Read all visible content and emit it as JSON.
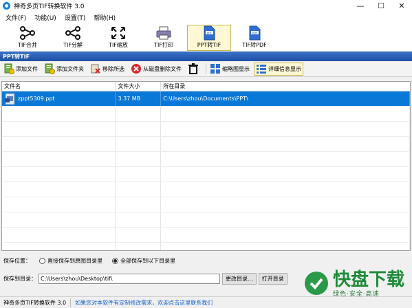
{
  "window": {
    "title": "神奇多页TIF转换软件 3.0",
    "controls": [
      "—",
      "☐",
      "✕"
    ]
  },
  "menu": [
    "文件(F)",
    "功能(U)",
    "设置(T)",
    "帮助(H)"
  ],
  "toolbar": [
    {
      "label": "TIF合并",
      "icon": "merge-icon",
      "active": false
    },
    {
      "label": "TIF分解",
      "icon": "split-icon",
      "active": false
    },
    {
      "label": "TIF缩放",
      "icon": "scale-icon",
      "active": false
    },
    {
      "label": "TIF打印",
      "icon": "printer-icon",
      "active": false
    },
    {
      "label": "PPT转TIF",
      "icon": "ppt-file-icon",
      "active": true
    },
    {
      "label": "TIF转PDF",
      "icon": "pdf-file-icon",
      "active": false
    }
  ],
  "section_title": "PPT转TIF",
  "actions": {
    "add_file": "添加文件",
    "add_folder": "添加文件夹",
    "remove_selected": "移除所选",
    "delete_from_disk": "从磁盘删除文件",
    "thumbnail_view": "缩略图显示",
    "detail_view": "详细信息显示"
  },
  "file_list": {
    "columns": [
      "文件名",
      "文件大小",
      "所在目录"
    ],
    "rows": [
      {
        "name": "zppt5309.ppt",
        "size": "3.37 MB",
        "dir": "C:\\Users\\zhou\\Documents\\PPT\\",
        "selected": true
      }
    ],
    "empty_rows": 10
  },
  "save": {
    "label": "保存位置：",
    "option1": "直接保存到原图目录里",
    "option2": "全部保存到以下目录里",
    "selected": 2,
    "dir_label": "保存到目录：",
    "dir_value": "C:\\Users\\zhou\\Desktop\\tif\\",
    "change_button": "更改目录...",
    "open_button": "打开目录"
  },
  "status": {
    "app": "神奇多页TIF转换软件 3.0",
    "link": "如果您对本软件有定制修改需求，欢迎点击这里联系我们"
  },
  "watermark": {
    "main": "快盘下载",
    "sub": "绿色·安全·高速"
  },
  "colors": {
    "selection": "#0a78d7",
    "header": "#2a5db0",
    "active_tool": "#fff8d4"
  }
}
